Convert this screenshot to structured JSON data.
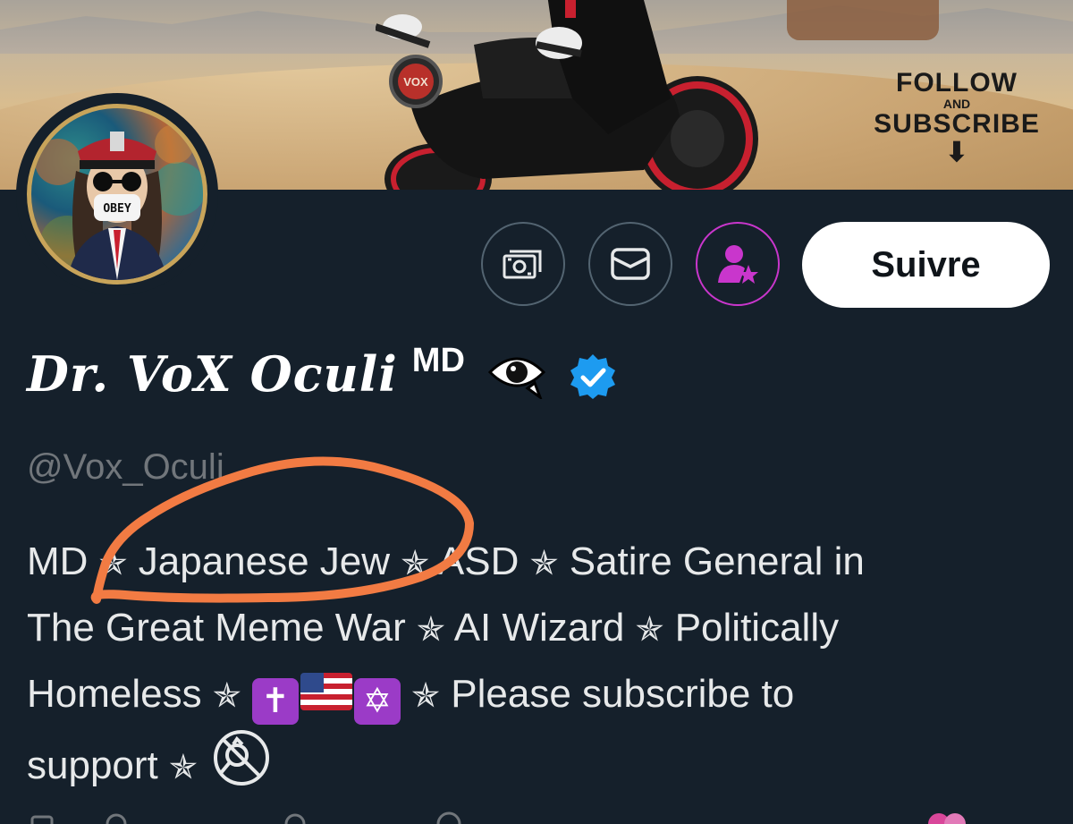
{
  "banner": {
    "bike_badge": "VOX",
    "follow_line1": "FOLLOW",
    "follow_line2": "AND",
    "follow_line3": "SUBSCRIBE",
    "follow_arrow": "⬇"
  },
  "avatar": {
    "mask_text": "OBEY"
  },
  "actions": {
    "tip_icon": "money-icon",
    "message_icon": "mail-icon",
    "subscribe_icon": "person-star-icon",
    "follow_label": "Suivre"
  },
  "profile": {
    "display_name": "Dr. VoX Oculi",
    "name_suffix": "MD",
    "eye_emoji": "👁",
    "verified": true,
    "handle": "@Vox_Oculi"
  },
  "bio": {
    "line1_a": "MD",
    "line1_b": "Japanese Jew",
    "line1_c": "ASD",
    "line1_d": "Satire General in",
    "line2_a": "The Great Meme War",
    "line2_b": "AI Wizard",
    "line2_c": "Politically",
    "line3_a": "Homeless",
    "line3_cross": "✝",
    "line3_star": "✡",
    "line3_b": "Please subscribe to",
    "line4_a": "support",
    "star": "✯"
  },
  "colors": {
    "background": "#15202b",
    "verified": "#1d9bf0",
    "subscribe_accent": "#c936cc",
    "annotation": "#f27b43"
  }
}
